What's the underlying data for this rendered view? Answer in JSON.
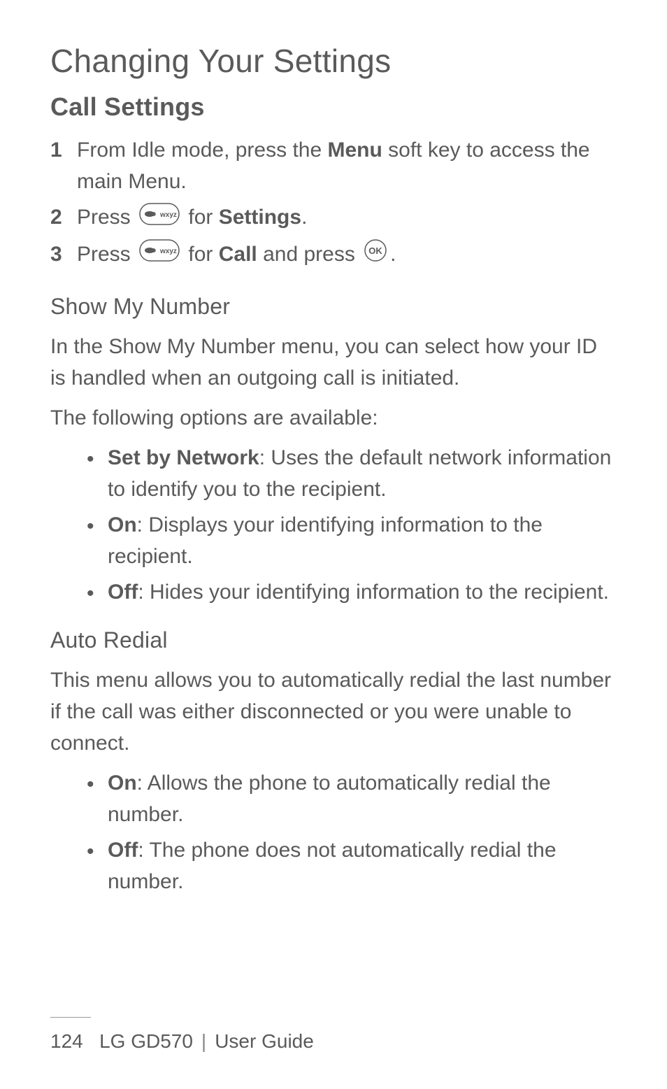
{
  "title": "Changing Your Settings",
  "section": "Call Settings",
  "steps": [
    {
      "num": "1",
      "parts": [
        {
          "text": "From Idle mode, press the "
        },
        {
          "text": "Menu",
          "bold": true
        },
        {
          "text": " soft key to access the main Menu."
        }
      ]
    },
    {
      "num": "2",
      "parts": [
        {
          "text": "Press "
        },
        {
          "icon": "wxyz-key"
        },
        {
          "text": " for "
        },
        {
          "text": "Settings",
          "bold": true
        },
        {
          "text": "."
        }
      ]
    },
    {
      "num": "3",
      "parts": [
        {
          "text": "Press "
        },
        {
          "icon": "wxyz-key"
        },
        {
          "text": " for "
        },
        {
          "text": "Call",
          "bold": true
        },
        {
          "text": " and press "
        },
        {
          "icon": "ok-key"
        },
        {
          "text": "."
        }
      ]
    }
  ],
  "subsections": [
    {
      "heading": "Show My Number",
      "paragraphs": [
        "In the Show My Number menu, you can select how your ID is handled when an outgoing call is initiated.",
        "The following options are available:"
      ],
      "bullets": [
        {
          "label": "Set by Network",
          "desc": ": Uses the default network information to identify you to the recipient."
        },
        {
          "label": "On",
          "desc": ": Displays your identifying information to the recipient."
        },
        {
          "label": "Off",
          "desc": ": Hides your identifying information to the recipient."
        }
      ]
    },
    {
      "heading": "Auto Redial",
      "paragraphs": [
        "This menu allows you to automatically redial the last number if the call was either disconnected or you were unable to connect."
      ],
      "bullets": [
        {
          "label": "On",
          "desc": ": Allows the phone to automatically redial the number."
        },
        {
          "label": "Off",
          "desc": ": The phone does not automatically redial the number."
        }
      ]
    }
  ],
  "footer": {
    "page": "124",
    "model": "LG GD570",
    "guide": "User Guide"
  }
}
